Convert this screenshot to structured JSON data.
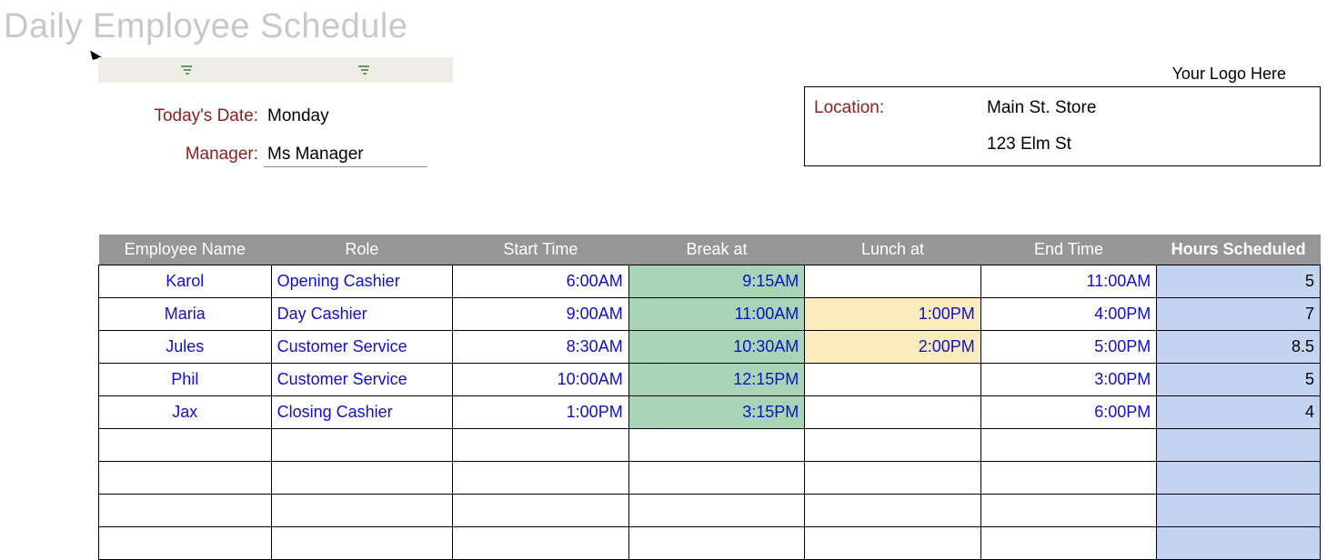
{
  "title": "Daily Employee Schedule",
  "logo_text": "Your Logo Here",
  "header": {
    "date_label": "Today's Date:",
    "date_value": "Monday",
    "manager_label": "Manager:",
    "manager_value": "Ms Manager"
  },
  "location": {
    "label": "Location:",
    "name": "Main St. Store",
    "address": "123 Elm St"
  },
  "table": {
    "headers": {
      "name": "Employee Name",
      "role": "Role",
      "start": "Start Time",
      "break": "Break at",
      "lunch": "Lunch at",
      "end": "End Time",
      "hours": "Hours Scheduled"
    },
    "rows": [
      {
        "name": "Karol",
        "role": "Opening Cashier",
        "start": "6:00AM",
        "break": "9:15AM",
        "lunch": "",
        "end": "11:00AM",
        "hours": "5"
      },
      {
        "name": "Maria",
        "role": "Day Cashier",
        "start": "9:00AM",
        "break": "11:00AM",
        "lunch": "1:00PM",
        "end": "4:00PM",
        "hours": "7"
      },
      {
        "name": "Jules",
        "role": "Customer Service",
        "start": "8:30AM",
        "break": "10:30AM",
        "lunch": "2:00PM",
        "end": "5:00PM",
        "hours": "8.5"
      },
      {
        "name": "Phil",
        "role": "Customer Service",
        "start": "10:00AM",
        "break": "12:15PM",
        "lunch": "",
        "end": "3:00PM",
        "hours": "5"
      },
      {
        "name": "Jax",
        "role": "Closing Cashier",
        "start": "1:00PM",
        "break": "3:15PM",
        "lunch": "",
        "end": "6:00PM",
        "hours": "4"
      },
      {
        "name": "",
        "role": "",
        "start": "",
        "break": "",
        "lunch": "",
        "end": "",
        "hours": ""
      },
      {
        "name": "",
        "role": "",
        "start": "",
        "break": "",
        "lunch": "",
        "end": "",
        "hours": ""
      },
      {
        "name": "",
        "role": "",
        "start": "",
        "break": "",
        "lunch": "",
        "end": "",
        "hours": ""
      },
      {
        "name": "",
        "role": "",
        "start": "",
        "break": "",
        "lunch": "",
        "end": "",
        "hours": ""
      }
    ]
  }
}
